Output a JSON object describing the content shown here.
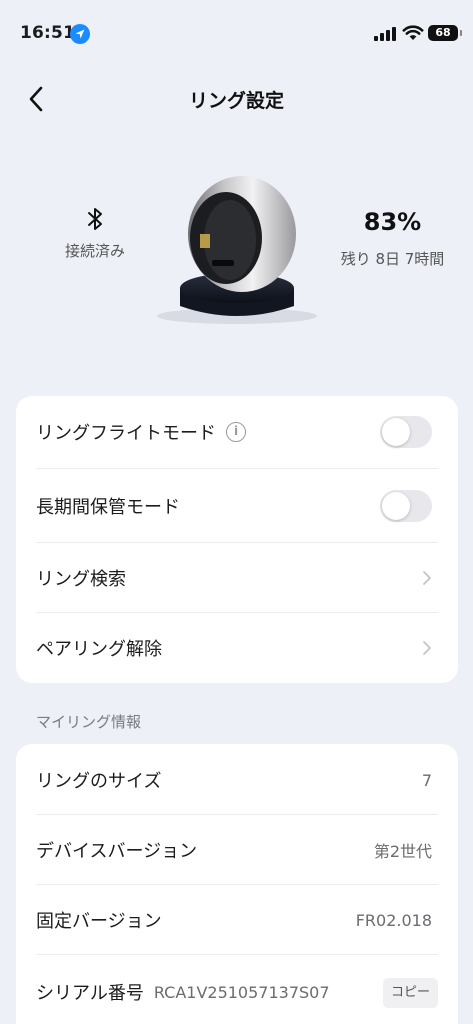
{
  "status_bar": {
    "time": "16:51",
    "battery": "68"
  },
  "header": {
    "title": "リング設定"
  },
  "ring": {
    "connection_status": "接続済み",
    "battery_percent": "83%",
    "battery_remaining": "残り 8日 7時間"
  },
  "settings": {
    "flight_mode_label": "リングフライトモード",
    "flight_mode_on": false,
    "storage_mode_label": "長期間保管モード",
    "storage_mode_on": false,
    "find_ring_label": "リング検索",
    "unpair_label": "ペアリング解除"
  },
  "my_ring": {
    "section_label": "マイリング情報",
    "size_label": "リングのサイズ",
    "size_value": "7",
    "device_version_label": "デバイスバージョン",
    "device_version_value": "第2世代",
    "firmware_label": "固定バージョン",
    "firmware_value": "FR02.018",
    "serial_label": "シリアル番号",
    "serial_value": "RCA1V251057137S07",
    "copy_label": "コピー"
  },
  "colors": {
    "background": "#eef0f8",
    "card": "#ffffff",
    "location_blue": "#1a8cff"
  }
}
